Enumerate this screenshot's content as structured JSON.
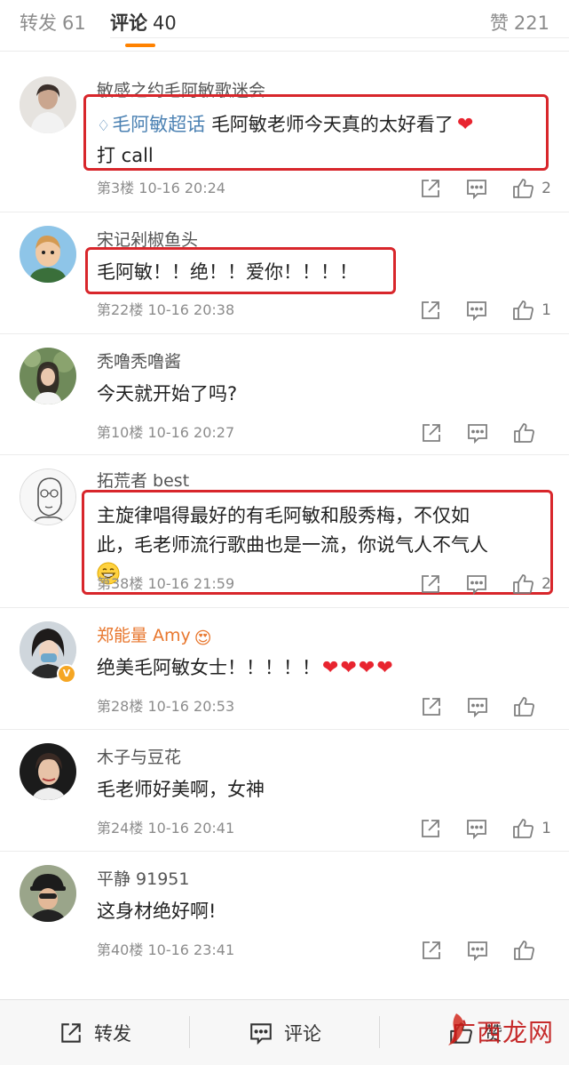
{
  "tabs": {
    "forward": {
      "label": "转发",
      "count": "61"
    },
    "comment": {
      "label": "评论",
      "count": "40"
    },
    "like": {
      "label": "赞",
      "count": "221"
    }
  },
  "comments": [
    {
      "user": "敏感之约毛阿敏歌迷会",
      "topic": "毛阿敏超话",
      "text_line1": "毛阿敏老师今天真的太好看了",
      "text_line2": "打 call",
      "floor": "第3楼",
      "time": "10-16 20:24",
      "likes": "2"
    },
    {
      "user": "宋记剁椒鱼头",
      "text": "毛阿敏！！绝！！爱你！！！！",
      "floor": "第22楼",
      "time": "10-16 20:38",
      "likes": "1"
    },
    {
      "user": "秃噜秃噜酱",
      "text": "今天就开始了吗?",
      "floor": "第10楼",
      "time": "10-16 20:27",
      "likes": ""
    },
    {
      "user": "拓荒者 best",
      "text_line1": "主旋律唱得最好的有毛阿敏和殷秀梅，不仅如",
      "text_line2": "此，毛老师流行歌曲也是一流，你说气人不气人",
      "floor": "第38楼",
      "time": "10-16 21:59",
      "likes": "2"
    },
    {
      "user": "郑能量 Amy",
      "text": "绝美毛阿敏女士！！！！！",
      "floor": "第28楼",
      "time": "10-16 20:53",
      "likes": ""
    },
    {
      "user": "木子与豆花",
      "text": "毛老师好美啊，女神",
      "floor": "第24楼",
      "time": "10-16 20:41",
      "likes": "1"
    },
    {
      "user": "平静 91951",
      "text": "这身材绝好啊!",
      "floor": "第40楼",
      "time": "10-16 23:41",
      "likes": ""
    }
  ],
  "bottom_bar": {
    "forward_label": "转发",
    "comment_label": "评论",
    "like_label": "赞"
  },
  "watermark": "广西龙网",
  "icons": [
    "share-icon",
    "comment-icon",
    "thumbs-up-icon",
    "heart-icon",
    "diamond-icon",
    "grin-emoji-icon"
  ],
  "colors": {
    "accent": "#ff8200",
    "topic_link": "#4c82b3",
    "highlight_box": "#d8262b",
    "heart": "#e8242f",
    "vip_name": "#e8772e"
  }
}
